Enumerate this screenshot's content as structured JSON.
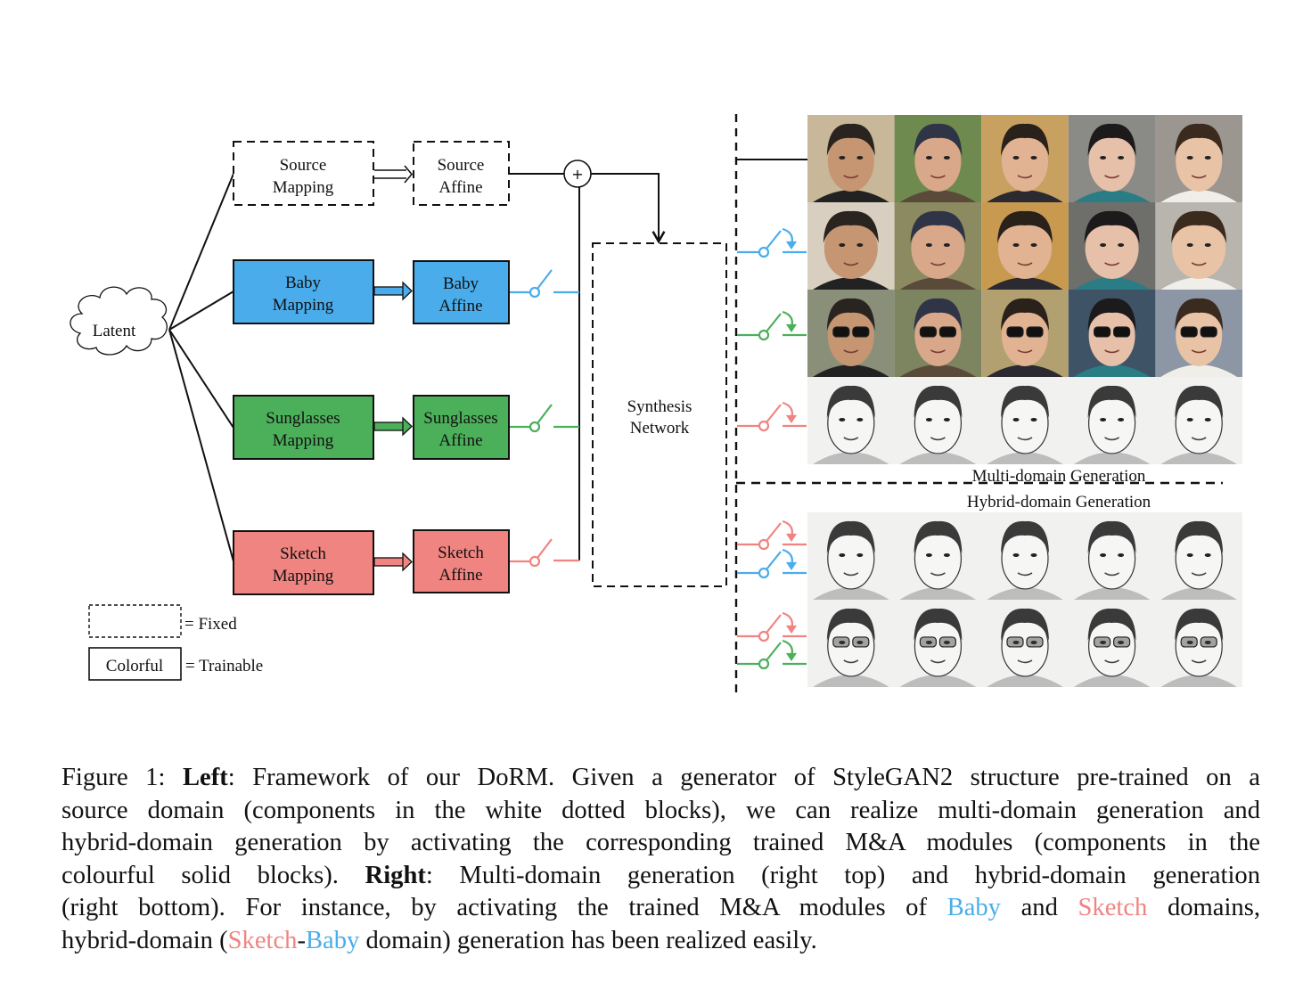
{
  "figure": {
    "latent_label": "Latent",
    "source_mapping": [
      "Source",
      "Mapping"
    ],
    "source_affine": [
      "Source",
      "Affine"
    ],
    "plus_symbol": "+",
    "modules": [
      {
        "name": "baby",
        "mapping": [
          "Baby",
          "Mapping"
        ],
        "affine": [
          "Baby",
          "Affine"
        ],
        "color": "#4aaceb"
      },
      {
        "name": "sunglasses",
        "mapping": [
          "Sunglasses",
          "Mapping"
        ],
        "affine": [
          "Sunglasses",
          "Affine"
        ],
        "color": "#4caf5a"
      },
      {
        "name": "sketch",
        "mapping": [
          "Sketch",
          "Mapping"
        ],
        "affine": [
          "Sketch",
          "Affine"
        ],
        "color": "#ef8480"
      }
    ],
    "synthesis": [
      "Synthesis",
      "Network"
    ],
    "legend": {
      "fixed_label": "= Fixed",
      "trainable_box_label": "Colorful",
      "trainable_label": "= Trainable"
    },
    "right": {
      "multi_domain_title": "Multi-domain Generation",
      "hybrid_domain_title": "Hybrid-domain Generation",
      "multi_rows": [
        {
          "domain": "source",
          "switches": []
        },
        {
          "domain": "baby",
          "switches": [
            "baby"
          ]
        },
        {
          "domain": "sunglasses",
          "switches": [
            "sunglasses"
          ]
        },
        {
          "domain": "sketch",
          "switches": [
            "sketch"
          ]
        }
      ],
      "hybrid_rows": [
        {
          "domain": "sketch-baby",
          "switches": [
            "sketch",
            "baby"
          ]
        },
        {
          "domain": "sketch-sunglasses",
          "switches": [
            "sketch",
            "sunglasses"
          ]
        }
      ],
      "columns": 5
    },
    "colors": {
      "baby": "#4aaceb",
      "sunglasses": "#4caf5a",
      "sketch": "#ef8480",
      "line": "#111111"
    }
  },
  "caption": {
    "lines": [
      [
        {
          "t": "Figure 1: "
        },
        {
          "t": "Left",
          "b": true
        },
        {
          "t": ": Framework of our DoRM. Given a generator of StyleGAN2 structure pre-trained on a"
        }
      ],
      [
        {
          "t": "source domain (components in the white dotted blocks), we can realize multi-domain generation and"
        }
      ],
      [
        {
          "t": "hybrid-domain generation by activating the corresponding trained M&A modules (components in the"
        }
      ],
      [
        {
          "t": "colourful solid blocks). "
        },
        {
          "t": "Right",
          "b": true
        },
        {
          "t": ": Multi-domain generation (right top) and hybrid-domain generation"
        }
      ],
      [
        {
          "t": "(right bottom). For instance, by activating the trained M&A modules of "
        },
        {
          "t": "Baby",
          "c": "baby"
        },
        {
          "t": " and "
        },
        {
          "t": "Sketch",
          "c": "sketch"
        },
        {
          "t": " domains,"
        }
      ],
      [
        {
          "t": "hybrid-domain ("
        },
        {
          "t": "Sketch",
          "c": "sketch"
        },
        {
          "t": "-"
        },
        {
          "t": "Baby",
          "c": "baby"
        },
        {
          "t": " domain) generation has been realized easily."
        }
      ]
    ]
  }
}
